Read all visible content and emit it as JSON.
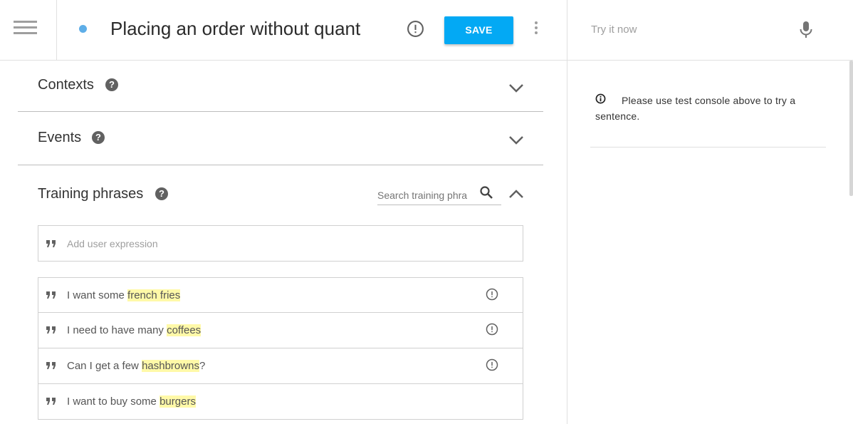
{
  "header": {
    "intent_title": "Placing an order without quant",
    "save_label": "SAVE",
    "try_placeholder": "Try it now"
  },
  "sections": {
    "contexts": "Contexts",
    "events": "Events",
    "training": "Training phrases"
  },
  "help_glyph": "?",
  "training": {
    "search_placeholder": "Search training phra",
    "add_placeholder": "Add user expression",
    "phrases": [
      {
        "before": "I want some ",
        "entity": "french fries",
        "after": "",
        "warning": true
      },
      {
        "before": "I need to have many ",
        "entity": "coffees",
        "after": "",
        "warning": true
      },
      {
        "before": "Can I get a few ",
        "entity": "hashbrowns",
        "after": "?",
        "warning": true
      },
      {
        "before": "I want to buy some ",
        "entity": "burgers",
        "after": "",
        "warning": false
      }
    ]
  },
  "console": {
    "info_text": "Please use test console above to try a sentence."
  },
  "icons": {
    "menu": "menu-icon",
    "status": "status-dot-icon",
    "warning": "warning-icon",
    "more": "more-vertical-icon",
    "mic": "microphone-icon",
    "help": "help-icon",
    "chevron_down": "chevron-down-icon",
    "chevron_up": "chevron-up-icon",
    "search": "search-icon",
    "quote": "quote-icon",
    "info": "info-icon"
  },
  "colors": {
    "accent": "#03a9f4",
    "status_dot": "#5eaee8",
    "entity_highlight": "#fff9a8"
  }
}
